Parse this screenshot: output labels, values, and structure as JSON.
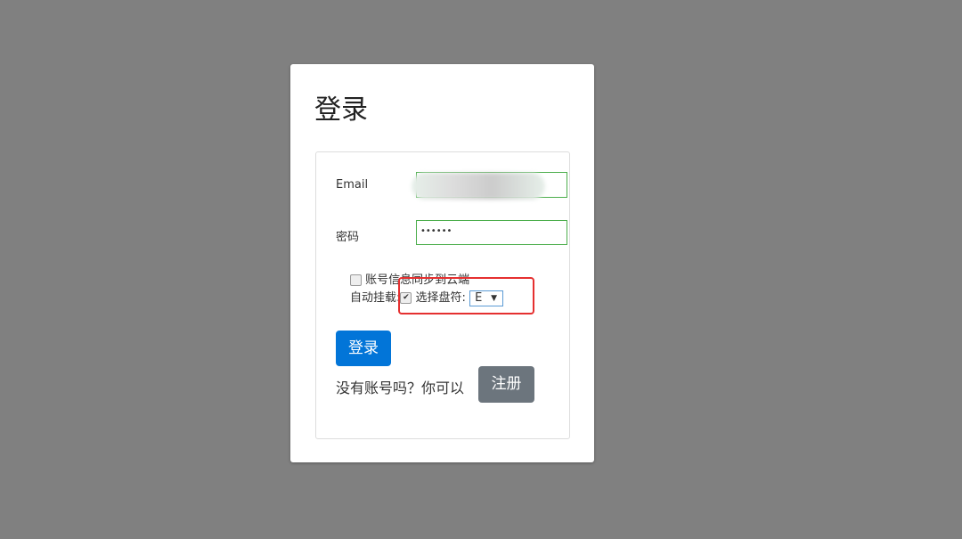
{
  "title": "登录",
  "email": {
    "label": "Email",
    "value": ""
  },
  "password": {
    "label": "密码",
    "value": "••••••"
  },
  "sync": {
    "label": "账号信息同步到云端",
    "checked": false
  },
  "mount": {
    "label": "自动挂载:",
    "checked": true,
    "drive_label": "选择盘符:",
    "drive_value": "E",
    "arrow": "▼"
  },
  "login_button": "登录",
  "register_prompt": "没有账号吗？你可以",
  "register_button": "注册",
  "colors": {
    "primary": "#0275d8",
    "secondary": "#6c757d",
    "highlight": "#e53030"
  }
}
